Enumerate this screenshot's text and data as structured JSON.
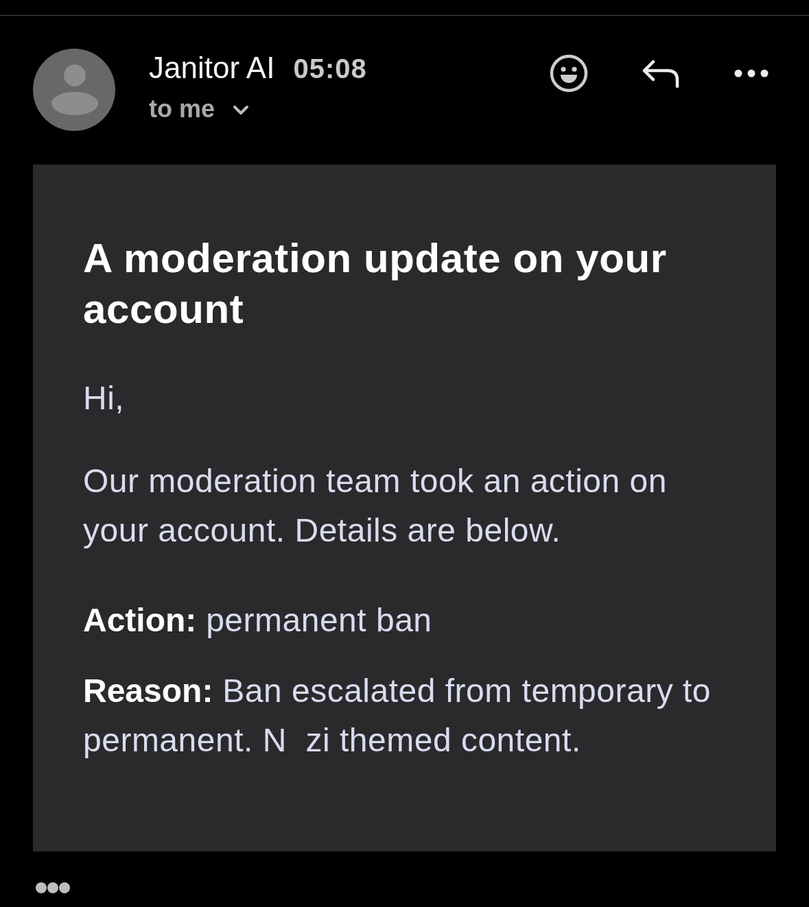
{
  "header": {
    "sender": "Janitor AI",
    "time": "05:08",
    "recipient": "to me"
  },
  "message": {
    "title": "A moderation update on your account",
    "greeting": "Hi,",
    "body": "Our moderation team took an action on your account. Details are below.",
    "details": [
      {
        "label": "Action:",
        "value": "permanent ban"
      },
      {
        "label": "Reason:",
        "value": "Ban escalated from temporary to permanent. N  zi themed content."
      }
    ]
  }
}
